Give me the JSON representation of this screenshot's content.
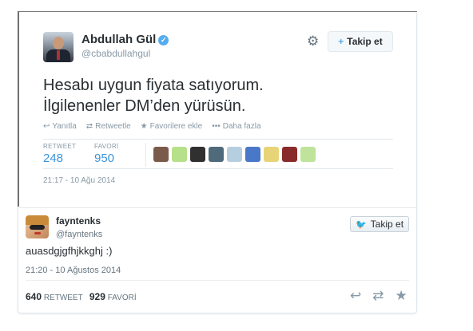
{
  "embedded_tweet": {
    "author_name": "Abdullah Gül",
    "verified_glyph": "✓",
    "handle": "@cbabdullahgul",
    "follow_label": "Takip et",
    "text_line1": "Hesabı uygun fiyata satıyorum.",
    "text_line2": "İlgilenenler DM’den yürüsün.",
    "actions": {
      "reply": "Yanıtla",
      "retweet": "Retweetle",
      "favorite": "Favorilere ekle",
      "more": "Daha fazla"
    },
    "stats": {
      "retweets_label": "RETWEET",
      "retweets": "248",
      "favorites_label": "FAVORİ",
      "favorites": "950"
    },
    "mini_avatar_colors": [
      "#7a5a4a",
      "#b7e08a",
      "#303030",
      "#4f6b7b",
      "#b6cfe0",
      "#4a78c8",
      "#e8d478",
      "#8a2b2b",
      "#bfe39a"
    ],
    "date": "21:17 - 10 Ağu 2014"
  },
  "outer_tweet": {
    "name": "fayntenks",
    "handle": "@fayntenks",
    "follow_label": "Takip et",
    "text": "auasdgjgfhjkkghj :)",
    "date": "21:20 - 10 Ağustos 2014",
    "retweets": "640",
    "retweets_label": "RETWEET",
    "favorites": "929",
    "favorites_label": "FAVORİ"
  },
  "icons": {
    "reply": "↩",
    "retweet": "⇄",
    "star": "★",
    "more": "•••",
    "gear": "⚙",
    "person_plus": "+",
    "bird": "🐦"
  },
  "colors": {
    "link_blue": "#3b94d9",
    "twitter_blue": "#55acee",
    "muted": "#8899a6"
  }
}
